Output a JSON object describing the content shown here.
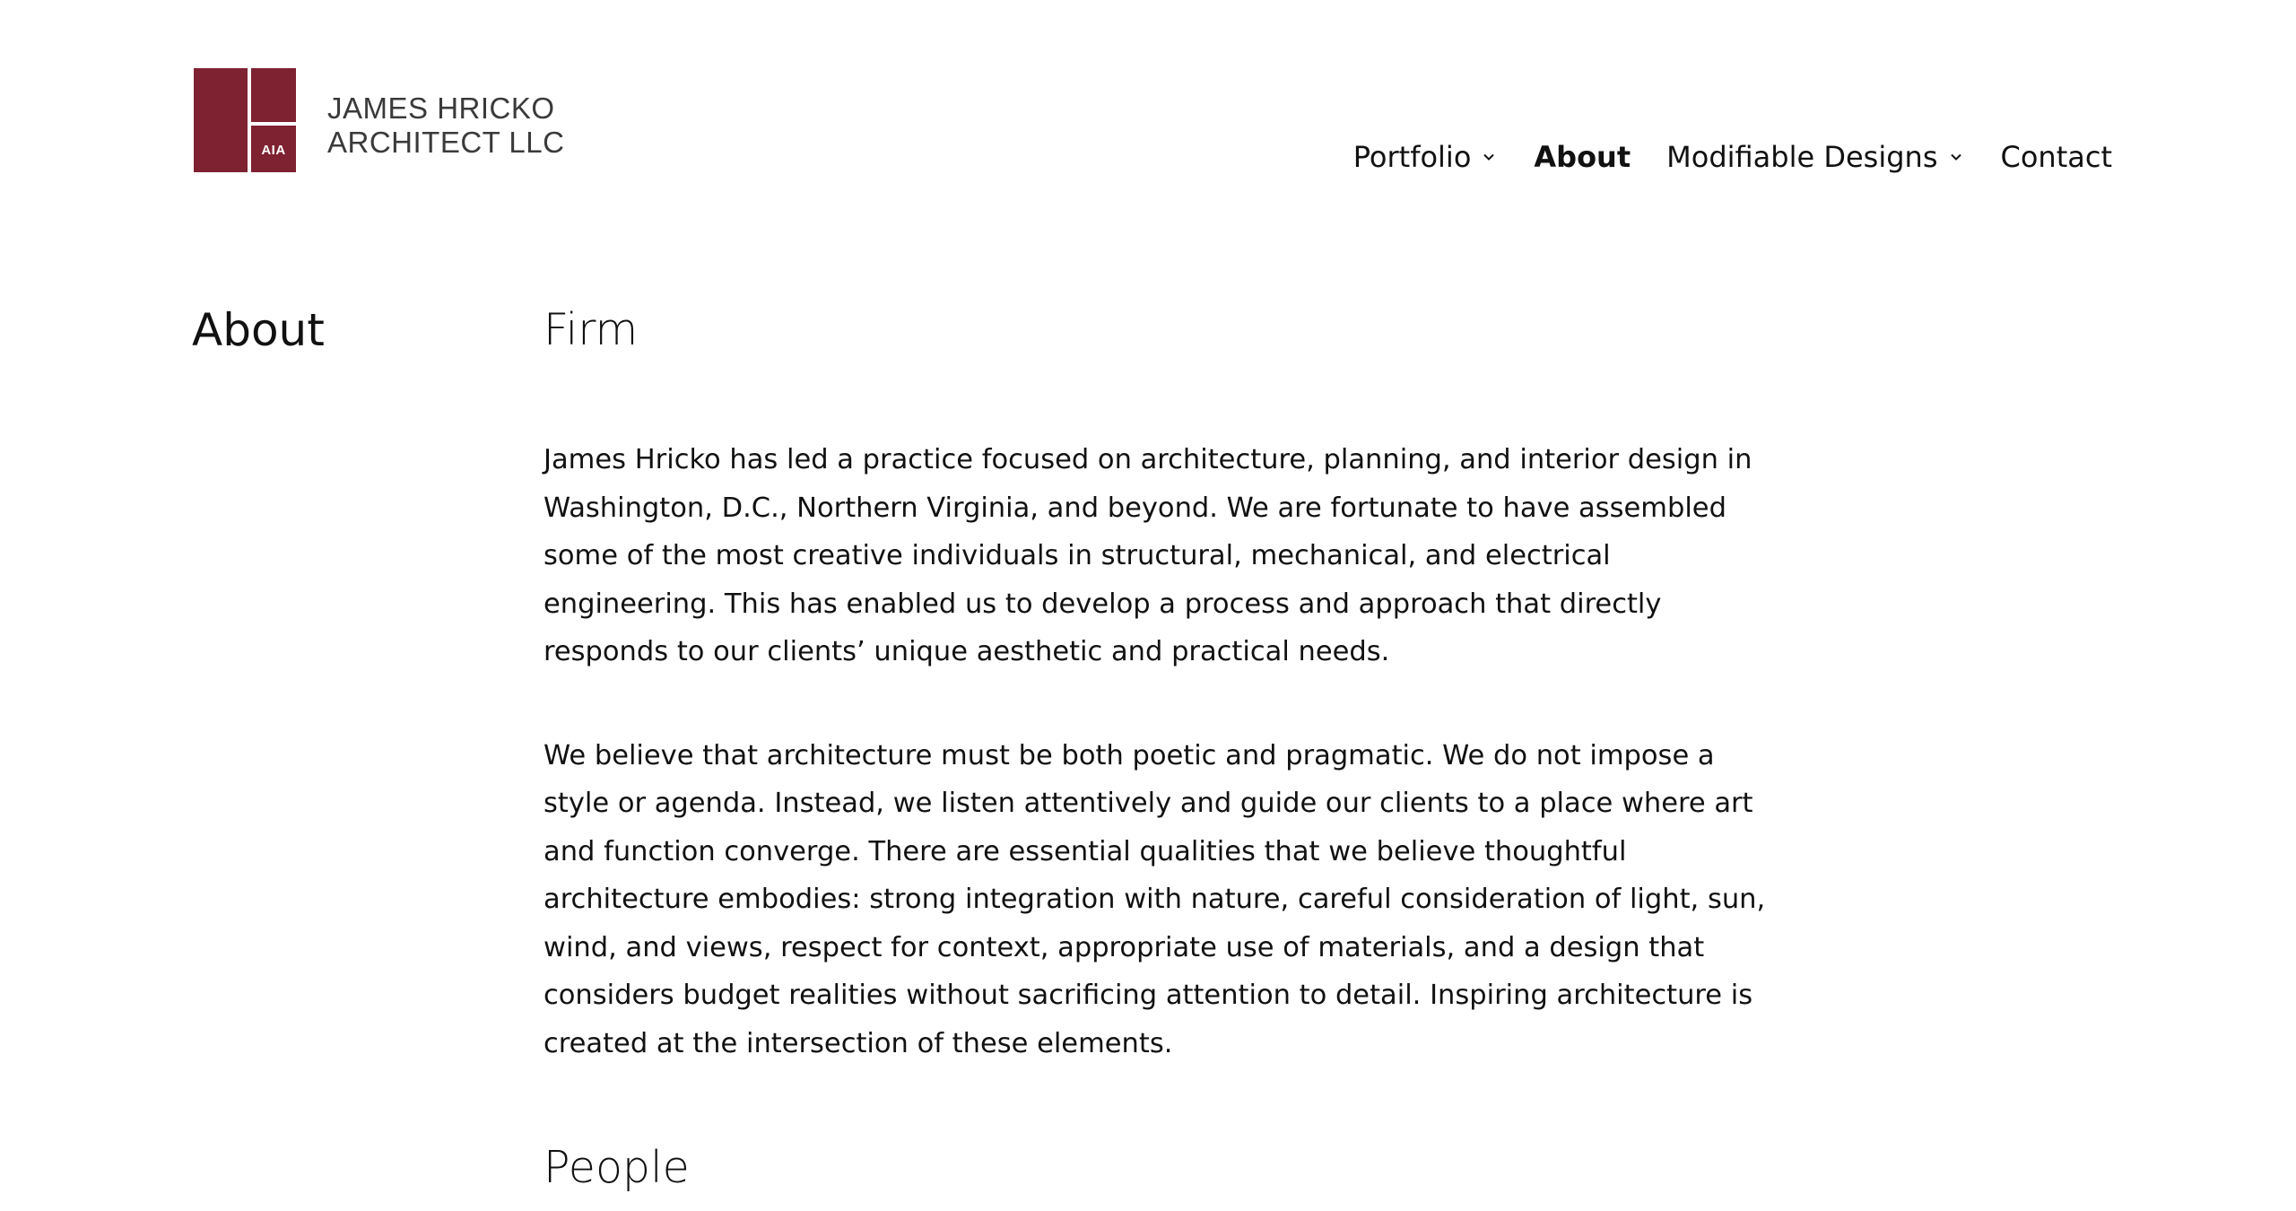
{
  "brand": {
    "mark_text": "AIA",
    "name_line1": "JAMES HRICKO",
    "name_line2": "ARCHITECT LLC",
    "color": "#7e2131"
  },
  "nav": {
    "items": [
      {
        "label": "Portfolio",
        "has_dropdown": true,
        "icon": "chevron-down-icon"
      },
      {
        "label": "About",
        "current": true
      },
      {
        "label": "Modifiable Designs",
        "has_dropdown": true,
        "icon": "chevron-down-icon"
      },
      {
        "label": "Contact"
      }
    ]
  },
  "page": {
    "heading": "About"
  },
  "sections": {
    "firm": {
      "title": "Firm",
      "paragraphs": [
        "James Hricko has led a practice focused on architecture, planning, and interior design in Washington, D.C., Northern Virginia, and beyond. We are fortunate to have assembled some of the most creative individuals in structural, mechanical, and electrical engineering. This has enabled us to develop a process and approach that directly responds to our clients’ unique aesthetic and practical needs.",
        "We believe that architecture must be both poetic and pragmatic. We do not impose a style or agenda. Instead, we listen attentively and guide our clients to a place where art and function converge. There are essential qualities that we believe thoughtful architecture embodies: strong integration with nature, careful consideration of light, sun, wind, and views, respect for context, appropriate use of materials, and a design that considers budget realities without sacrificing attention to detail. Inspiring architecture is created at the intersection of these elements."
      ]
    },
    "people": {
      "title": "People"
    }
  }
}
